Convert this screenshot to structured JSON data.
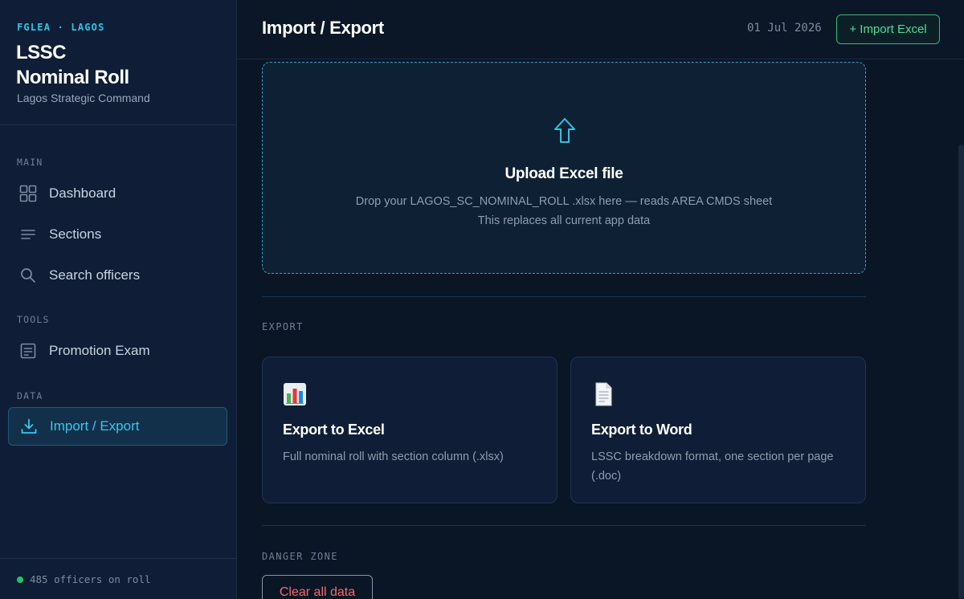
{
  "sidebar": {
    "org": "FGLEA · LAGOS",
    "title_line1": "LSSC",
    "title_line2": "Nominal Roll",
    "subtitle": "Lagos Strategic Command",
    "sections": {
      "main": "MAIN",
      "tools": "TOOLS",
      "data": "DATA"
    },
    "items": {
      "dashboard": "Dashboard",
      "sections": "Sections",
      "search": "Search officers",
      "promotion": "Promotion Exam",
      "import_export": "Import / Export"
    },
    "active": "import_export",
    "footer_status": "485 officers on roll"
  },
  "topbar": {
    "title": "Import / Export",
    "date": "01 Jul 2026",
    "import_button": "+ Import Excel"
  },
  "upload": {
    "title": "Upload Excel file",
    "line1": "Drop your LAGOS_SC_NOMINAL_ROLL .xlsx here — reads AREA CMDS sheet",
    "line2": "This replaces all current app data"
  },
  "export": {
    "label": "EXPORT",
    "excel": {
      "title": "Export to Excel",
      "desc": "Full nominal roll with section column (.xlsx)",
      "icon": "bar-chart-icon"
    },
    "word": {
      "title": "Export to Word",
      "desc": "LSSC breakdown format, one section per page (.doc)",
      "icon": "document-icon"
    }
  },
  "danger": {
    "label": "DANGER ZONE",
    "clear_button": "Clear all data"
  },
  "colors": {
    "accent": "#38c6ee",
    "success": "#4ade9a",
    "danger": "#f26b6b",
    "background": "#0a1526",
    "sidebar": "#0f1e36"
  }
}
